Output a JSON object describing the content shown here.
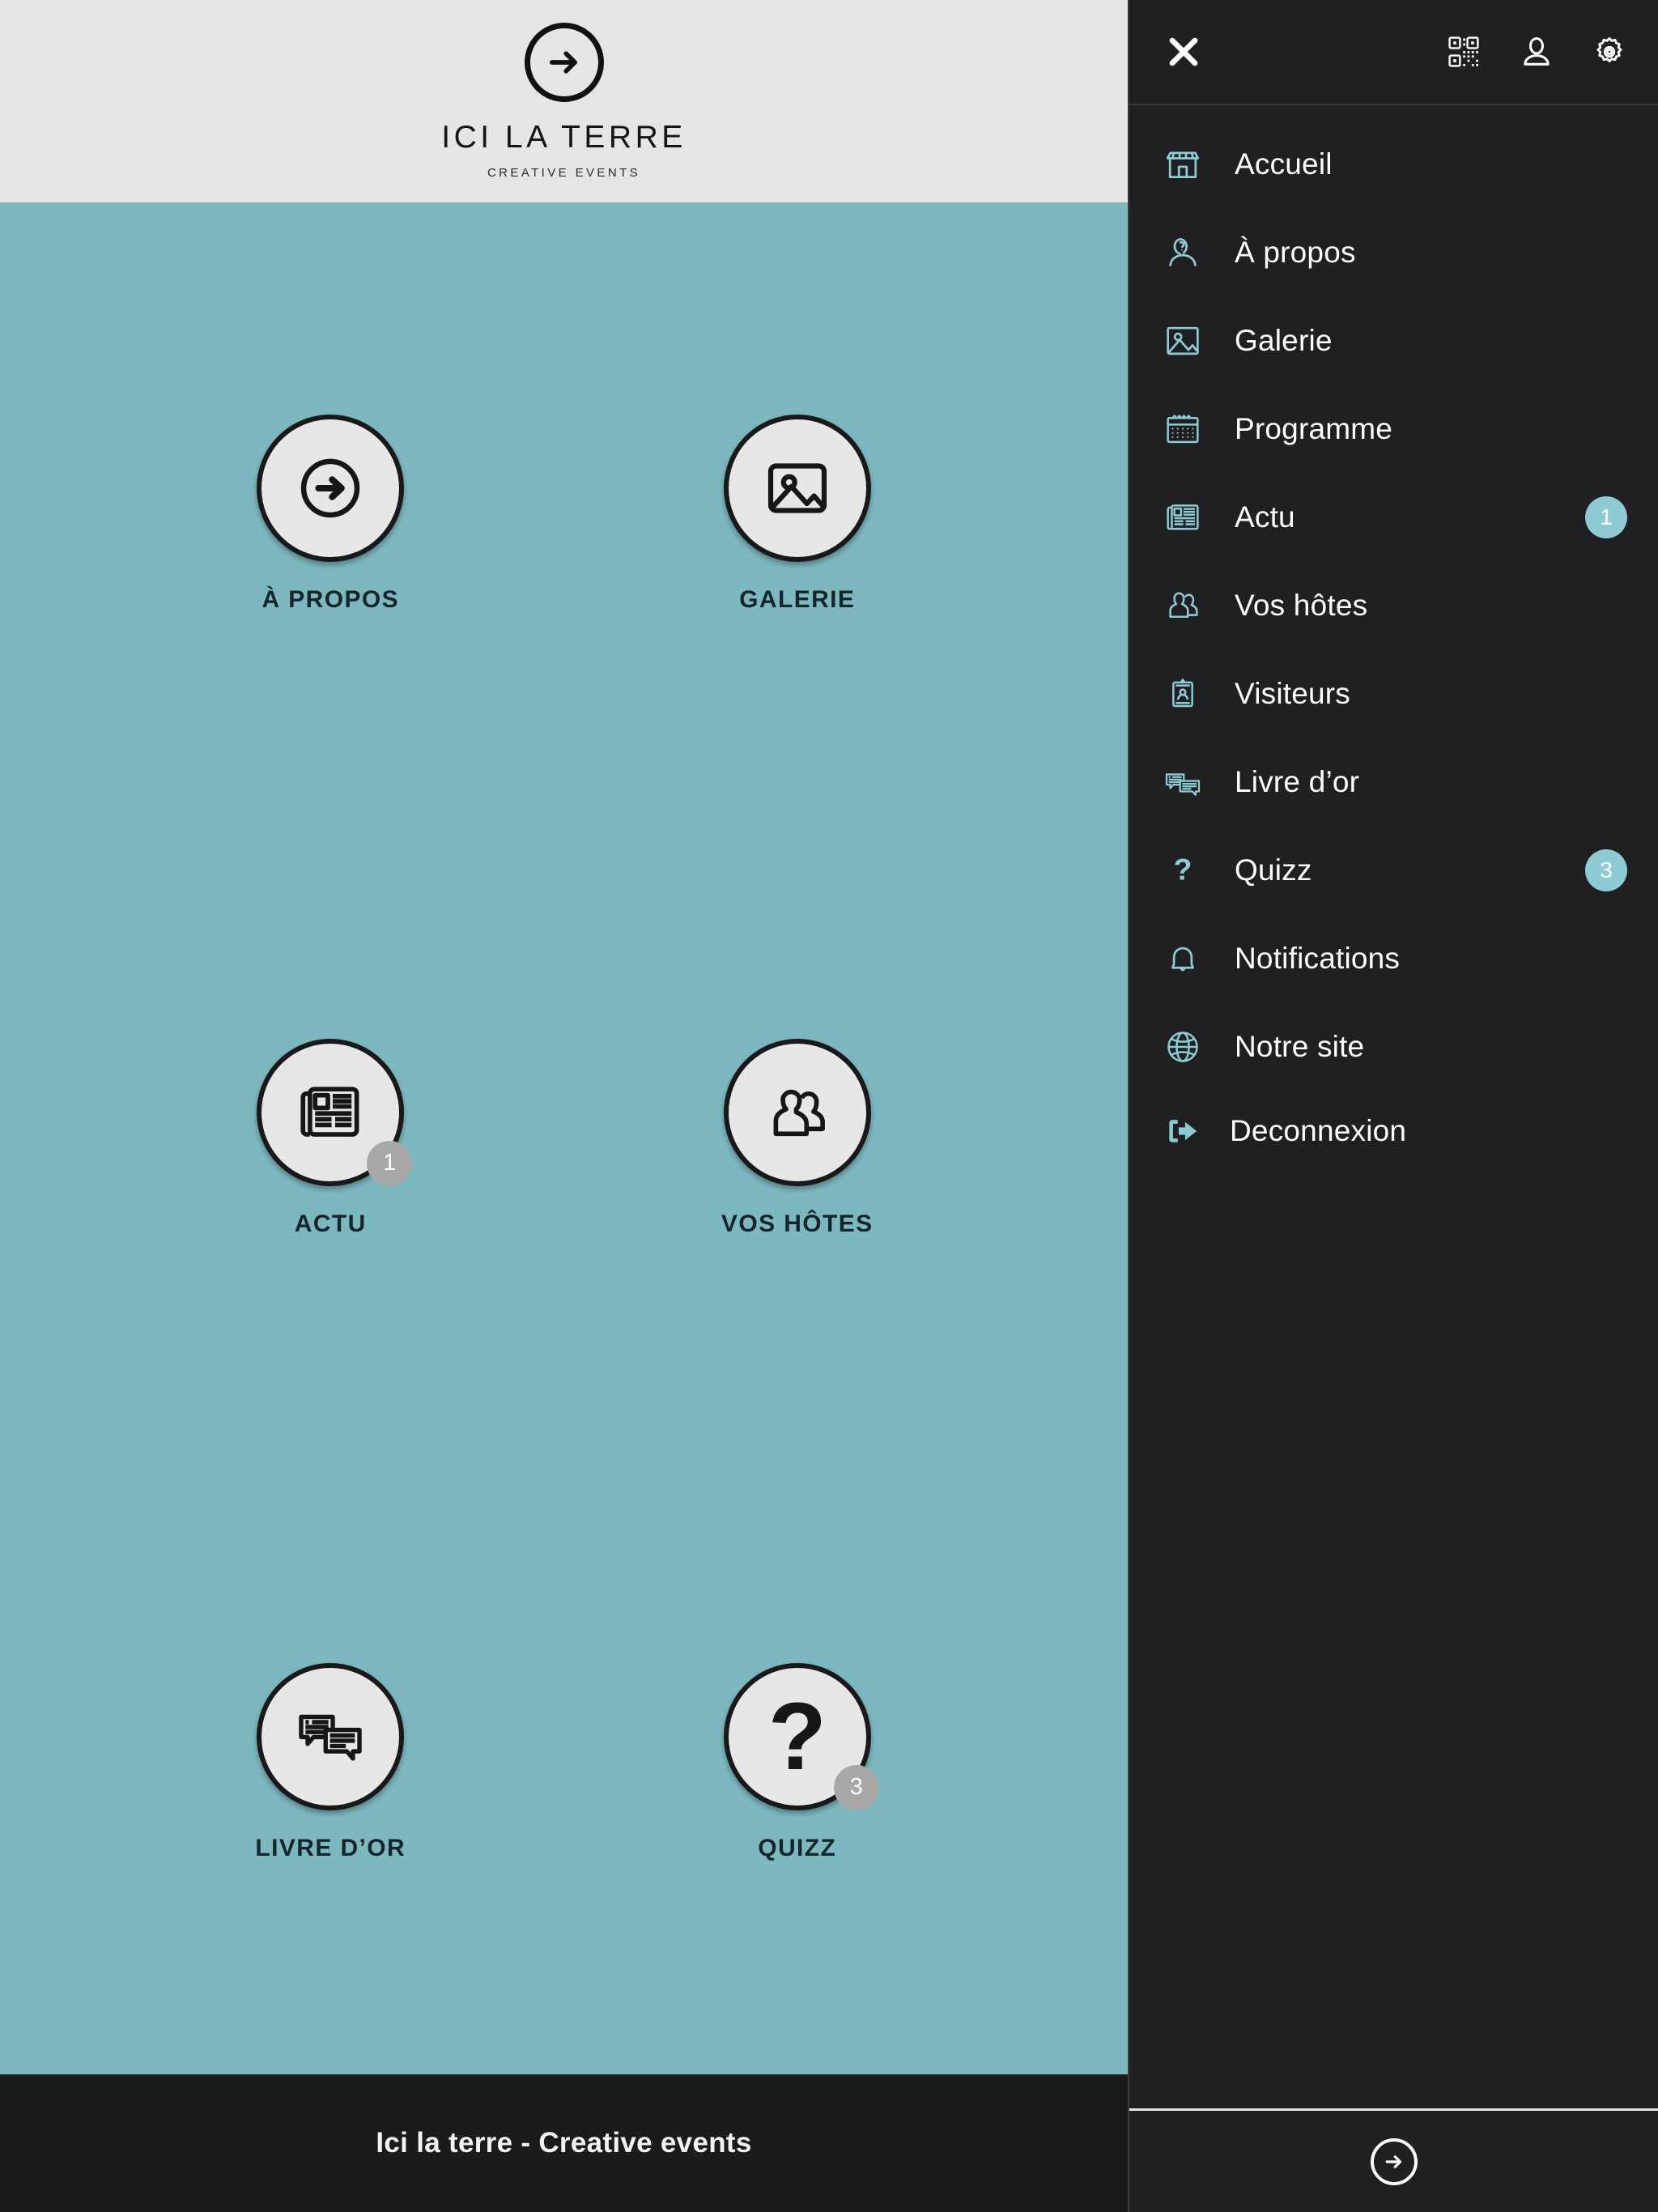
{
  "colors": {
    "teal_background": "#7db8c0",
    "sidebar_dark": "#202023",
    "header_gray": "#e5e5e5",
    "badge_teal": "#8ecbd4",
    "tile_badge_gray": "#a8a8a8",
    "icon_teal": "#8ecbd4"
  },
  "brand": {
    "mark_icon": "arrow-right-circle-icon",
    "name": "ICI LA TERRE",
    "tagline": "CREATIVE EVENTS"
  },
  "tiles": [
    {
      "id": "a-propos",
      "label": "À PROPOS",
      "icon": "arrow-right-circle-icon",
      "badge": null
    },
    {
      "id": "galerie",
      "label": "GALERIE",
      "icon": "image-icon",
      "badge": null
    },
    {
      "id": "actu",
      "label": "ACTU",
      "icon": "newspaper-icon",
      "badge": "1"
    },
    {
      "id": "vos-hotes",
      "label": "VOS HÔTES",
      "icon": "two-people-icon",
      "badge": null
    },
    {
      "id": "livre-dor",
      "label": "LIVRE D’OR",
      "icon": "chat-bubbles-icon",
      "badge": null
    },
    {
      "id": "quizz",
      "label": "QUIZZ",
      "icon": "question-mark-icon",
      "badge": "3"
    }
  ],
  "footer": {
    "text": "Ici la terre - Creative events"
  },
  "sidebar": {
    "topbar": {
      "close_icon": "close-icon",
      "actions": [
        {
          "id": "qrcode",
          "icon": "qr-code-icon"
        },
        {
          "id": "profile",
          "icon": "person-icon"
        },
        {
          "id": "settings",
          "icon": "gear-icon"
        }
      ]
    },
    "items": [
      {
        "id": "accueil",
        "label": "Accueil",
        "icon": "store-icon",
        "badge": null
      },
      {
        "id": "a-propos",
        "label": "À propos",
        "icon": "person-question-icon",
        "badge": null
      },
      {
        "id": "galerie",
        "label": "Galerie",
        "icon": "image-icon",
        "badge": null
      },
      {
        "id": "programme",
        "label": "Programme",
        "icon": "calendar-icon",
        "badge": null
      },
      {
        "id": "actu",
        "label": "Actu",
        "icon": "newspaper-icon",
        "badge": "1"
      },
      {
        "id": "vos-hotes",
        "label": "Vos hôtes",
        "icon": "two-people-icon",
        "badge": null
      },
      {
        "id": "visiteurs",
        "label": "Visiteurs",
        "icon": "badge-card-icon",
        "badge": null
      },
      {
        "id": "livre-dor",
        "label": "Livre d’or",
        "icon": "chat-bubbles-icon",
        "badge": null
      },
      {
        "id": "quizz",
        "label": "Quizz",
        "icon": "question-mark-icon",
        "badge": "3"
      },
      {
        "id": "notifications",
        "label": "Notifications",
        "icon": "bell-icon",
        "badge": null
      },
      {
        "id": "notre-site",
        "label": "Notre site",
        "icon": "globe-icon",
        "badge": null
      },
      {
        "id": "deconnexion",
        "label": "Deconnexion",
        "icon": "logout-icon",
        "badge": null
      }
    ],
    "footer": {
      "mark_icon": "arrow-right-circle-icon"
    }
  }
}
